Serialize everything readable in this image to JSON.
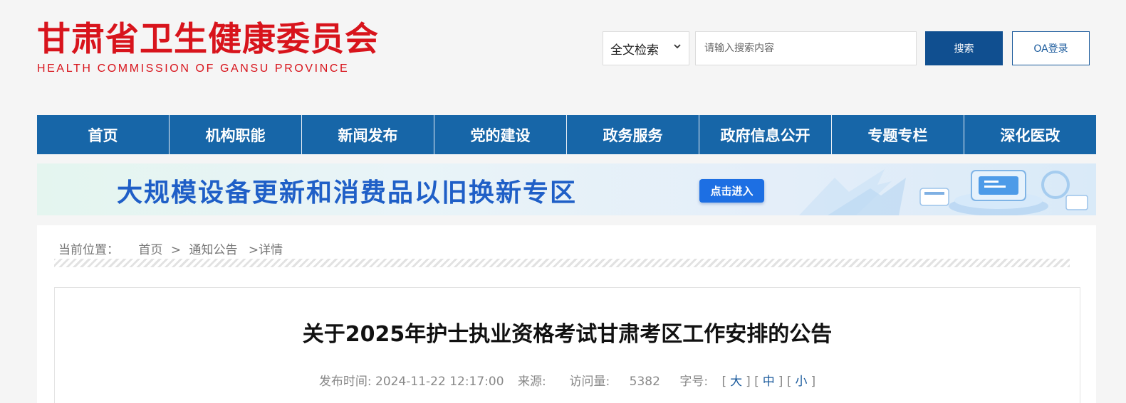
{
  "header": {
    "logo_cn": "甘肃省卫生健康委员会",
    "logo_en": "HEALTH COMMISSION OF GANSU PROVINCE",
    "search_scope": "全文检索",
    "search_placeholder": "请输入搜索内容",
    "search_button": "搜索",
    "oa_button": "OA登录"
  },
  "nav": {
    "items": [
      "首页",
      "机构职能",
      "新闻发布",
      "党的建设",
      "政务服务",
      "政府信息公开",
      "专题专栏",
      "深化医改"
    ]
  },
  "banner": {
    "title": "大规模设备更新和消费品以旧换新专区",
    "button": "点击进入"
  },
  "breadcrumb": {
    "label": "当前位置：",
    "home": "首页",
    "sep": ">",
    "section": "通知公告",
    "current": ">详情"
  },
  "article": {
    "title": "关于2025年护士执业资格考试甘肃考区工作安排的公告",
    "publish_label": "发布时间:",
    "publish_time": "2024-11-22 12:17:00",
    "source_label": "来源:",
    "source": "",
    "views_label": "访问量:",
    "views": "5382",
    "fontsize_label": "字号:",
    "font_large": "大",
    "font_medium": "中",
    "font_small": "小"
  },
  "colors": {
    "brand_red": "#d8141c",
    "nav_blue": "#1766a8",
    "search_button_blue": "#104f90"
  }
}
